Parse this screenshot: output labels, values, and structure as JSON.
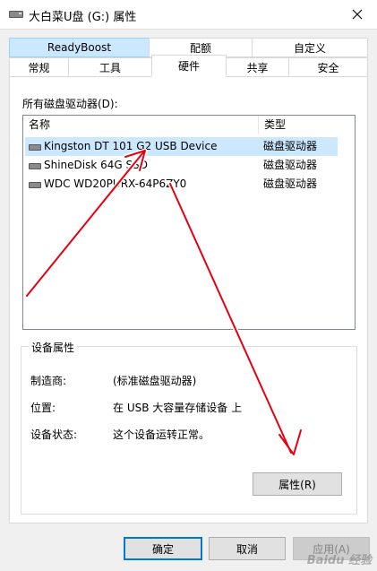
{
  "window": {
    "title": "大白菜U盘 (G:) 属性"
  },
  "tabs": {
    "row1": [
      "ReadyBoost",
      "配额",
      "自定义"
    ],
    "row2": [
      "常规",
      "工具",
      "硬件",
      "共享",
      "安全"
    ]
  },
  "drives": {
    "label": "所有磁盘驱动器(D):",
    "columns": {
      "name": "名称",
      "type": "类型"
    },
    "rows": [
      {
        "name": "Kingston DT 101 G2 USB Device",
        "type": "磁盘驱动器"
      },
      {
        "name": "ShineDisk 64G SSD",
        "type": "磁盘驱动器"
      },
      {
        "name": "WDC WD20PURX-64P6ZY0",
        "type": "磁盘驱动器"
      }
    ]
  },
  "device_props": {
    "title": "设备属性",
    "manufacturer_label": "制造商:",
    "manufacturer_value": "(标准磁盘驱动器)",
    "location_label": "位置:",
    "location_value": "在 USB 大容量存储设备 上",
    "status_label": "设备状态:",
    "status_value": "这个设备运转正常。",
    "properties_button": "属性(R)"
  },
  "buttons": {
    "ok": "确定",
    "cancel": "取消",
    "apply": "应用(A)"
  },
  "watermark": "Baidu 经验",
  "colors": {
    "accent": "#0078d7",
    "selection": "#cce8ff",
    "annotation": "#e60012"
  }
}
